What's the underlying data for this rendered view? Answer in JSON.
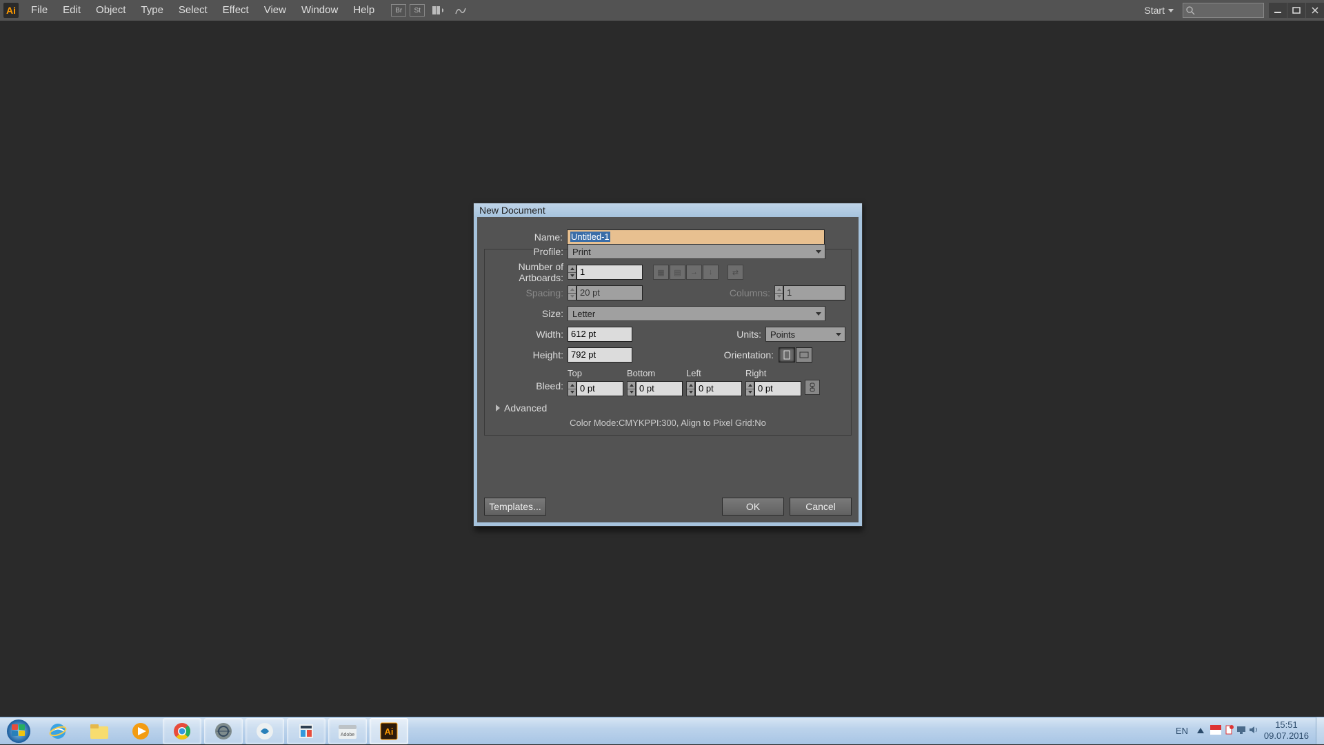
{
  "app": {
    "logo": "Ai"
  },
  "menu": [
    "File",
    "Edit",
    "Object",
    "Type",
    "Select",
    "Effect",
    "View",
    "Window",
    "Help"
  ],
  "topRight": {
    "start": "Start"
  },
  "dialog": {
    "title": "New Document",
    "name_label": "Name:",
    "name_value": "Untitled-1",
    "profile_label": "Profile:",
    "profile_value": "Print",
    "artboards_label": "Number of Artboards:",
    "artboards_value": "1",
    "spacing_label": "Spacing:",
    "spacing_value": "20 pt",
    "columns_label": "Columns:",
    "columns_value": "1",
    "size_label": "Size:",
    "size_value": "Letter",
    "width_label": "Width:",
    "width_value": "612 pt",
    "units_label": "Units:",
    "units_value": "Points",
    "height_label": "Height:",
    "height_value": "792 pt",
    "orientation_label": "Orientation:",
    "bleed_label": "Bleed:",
    "bleed_top": "Top",
    "bleed_bottom": "Bottom",
    "bleed_left": "Left",
    "bleed_right": "Right",
    "bleed_value": "0 pt",
    "advanced": "Advanced",
    "info": "Color Mode:CMYKPPI:300, Align to Pixel Grid:No",
    "templates_btn": "Templates...",
    "ok_btn": "OK",
    "cancel_btn": "Cancel"
  },
  "taskbar": {
    "lang": "EN",
    "time": "15:51",
    "date": "09.07.2016"
  }
}
